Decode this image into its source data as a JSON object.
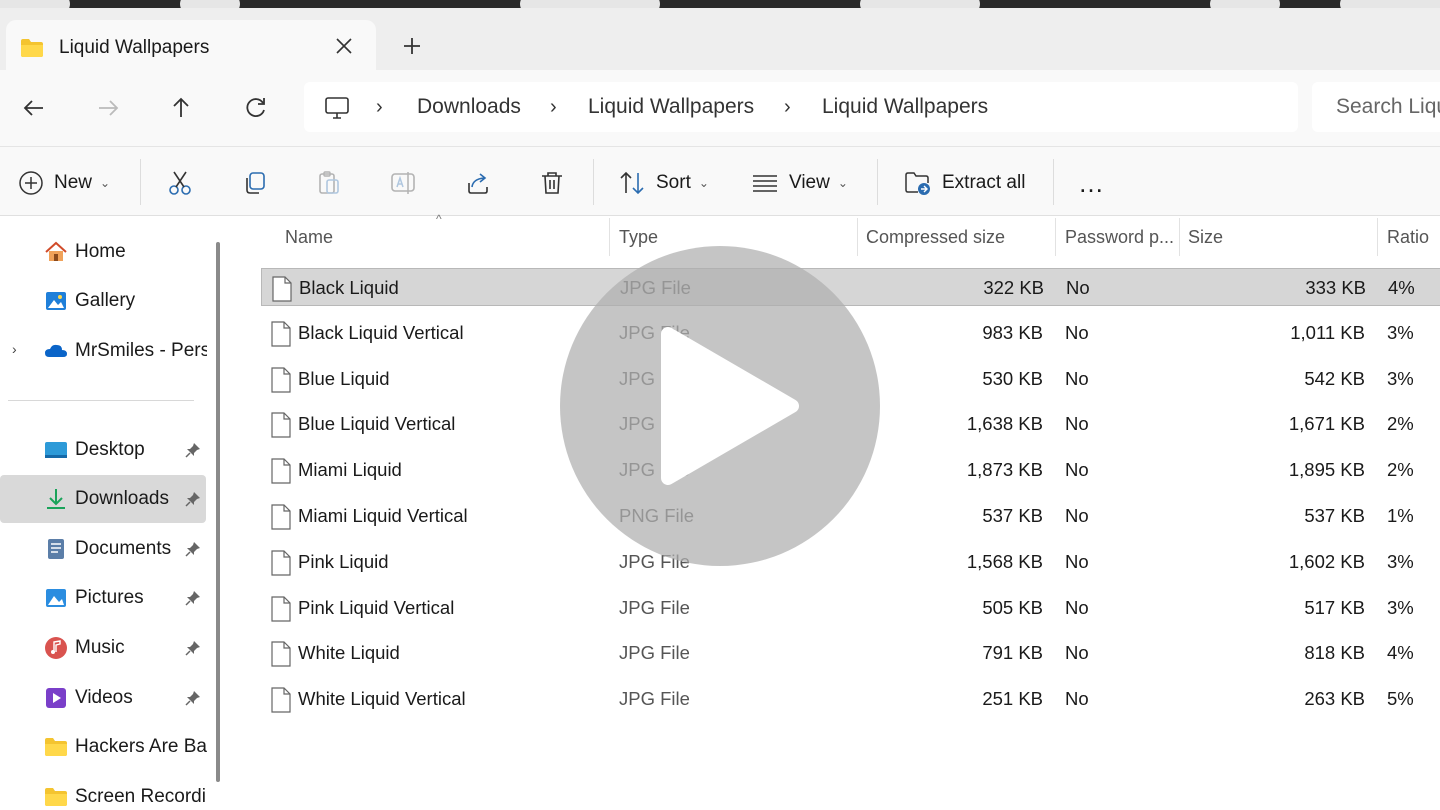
{
  "window": {
    "tab_title": "Liquid Wallpapers"
  },
  "address": {
    "breadcrumbs": [
      "Downloads",
      "Liquid Wallpapers",
      "Liquid Wallpapers"
    ],
    "search_placeholder": "Search Liquid Wallpapers"
  },
  "toolbar": {
    "new_label": "New",
    "sort_label": "Sort",
    "view_label": "View",
    "extract_label": "Extract all",
    "more_label": "…"
  },
  "sidebar": {
    "items": [
      {
        "label": "Home",
        "icon": "home-icon"
      },
      {
        "label": "Gallery",
        "icon": "gallery-icon"
      },
      {
        "label": "MrSmiles - Personal",
        "icon": "onedrive-icon"
      },
      {
        "label": "Desktop",
        "icon": "desktop-icon"
      },
      {
        "label": "Downloads",
        "icon": "downloads-icon"
      },
      {
        "label": "Documents",
        "icon": "documents-icon"
      },
      {
        "label": "Pictures",
        "icon": "pictures-icon"
      },
      {
        "label": "Music",
        "icon": "music-icon"
      },
      {
        "label": "Videos",
        "icon": "videos-icon"
      },
      {
        "label": "Hackers Are Back",
        "icon": "folder-icon"
      },
      {
        "label": "Screen Recordings",
        "icon": "folder-icon"
      }
    ]
  },
  "columns": {
    "name": "Name",
    "type": "Type",
    "compressed": "Compressed size",
    "password": "Password p...",
    "size": "Size",
    "ratio": "Ratio"
  },
  "files": [
    {
      "name": "Black Liquid",
      "type": "JPG File",
      "compressed": "322 KB",
      "password": "No",
      "size": "333 KB",
      "ratio": "4%"
    },
    {
      "name": "Black Liquid Vertical",
      "type": "JPG File",
      "compressed": "983 KB",
      "password": "No",
      "size": "1,011 KB",
      "ratio": "3%"
    },
    {
      "name": "Blue Liquid",
      "type": "JPG File",
      "compressed": "530 KB",
      "password": "No",
      "size": "542 KB",
      "ratio": "3%"
    },
    {
      "name": "Blue Liquid Vertical",
      "type": "JPG File",
      "compressed": "1,638 KB",
      "password": "No",
      "size": "1,671 KB",
      "ratio": "2%"
    },
    {
      "name": "Miami Liquid",
      "type": "JPG File",
      "compressed": "1,873 KB",
      "password": "No",
      "size": "1,895 KB",
      "ratio": "2%"
    },
    {
      "name": "Miami Liquid Vertical",
      "type": "PNG File",
      "compressed": "537 KB",
      "password": "No",
      "size": "537 KB",
      "ratio": "1%"
    },
    {
      "name": "Pink Liquid",
      "type": "JPG File",
      "compressed": "1,568 KB",
      "password": "No",
      "size": "1,602 KB",
      "ratio": "3%"
    },
    {
      "name": "Pink Liquid Vertical",
      "type": "JPG File",
      "compressed": "505 KB",
      "password": "No",
      "size": "517 KB",
      "ratio": "3%"
    },
    {
      "name": "White Liquid",
      "type": "JPG File",
      "compressed": "791 KB",
      "password": "No",
      "size": "818 KB",
      "ratio": "4%"
    },
    {
      "name": "White Liquid Vertical",
      "type": "JPG File",
      "compressed": "251 KB",
      "password": "No",
      "size": "263 KB",
      "ratio": "5%"
    }
  ],
  "colors": {
    "selection": "#d6d6d6",
    "folder_yellow": "#f4c430",
    "accent_blue": "#0078d4"
  }
}
